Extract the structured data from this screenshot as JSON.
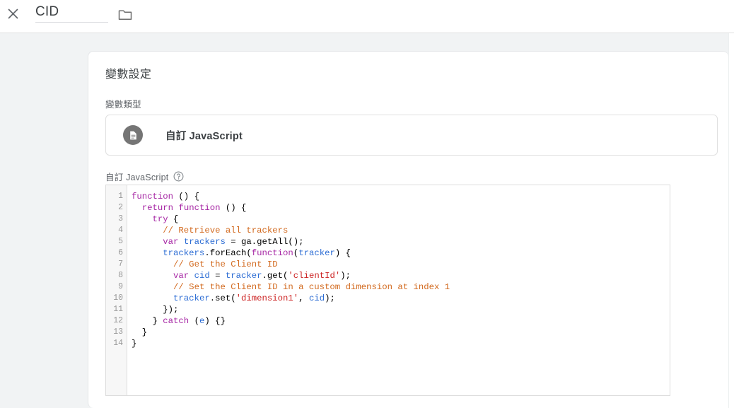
{
  "topbar": {
    "close_icon": "close-icon",
    "name_value": "CID",
    "folder_icon": "folder-icon"
  },
  "card": {
    "title": "變數設定",
    "variable_type_label": "變數類型",
    "variable_type": {
      "icon": "document-icon",
      "name": "自訂 JavaScript"
    },
    "code_label": "自訂 JavaScript",
    "help_icon": "help-circle-icon"
  },
  "editor": {
    "line_numbers": [
      1,
      2,
      3,
      4,
      5,
      6,
      7,
      8,
      9,
      10,
      11,
      12,
      13,
      14
    ],
    "lines": [
      [
        [
          "kw",
          "function"
        ],
        [
          "pln",
          " () {"
        ]
      ],
      [
        [
          "pln",
          "  "
        ],
        [
          "kw",
          "return"
        ],
        [
          "pln",
          " "
        ],
        [
          "kw",
          "function"
        ],
        [
          "pln",
          " () {"
        ]
      ],
      [
        [
          "pln",
          "    "
        ],
        [
          "kw",
          "try"
        ],
        [
          "pln",
          " {"
        ]
      ],
      [
        [
          "pln",
          "      "
        ],
        [
          "com",
          "// Retrieve all trackers"
        ]
      ],
      [
        [
          "pln",
          "      "
        ],
        [
          "kw",
          "var"
        ],
        [
          "pln",
          " "
        ],
        [
          "var",
          "trackers"
        ],
        [
          "pln",
          " = ga.getAll();"
        ]
      ],
      [
        [
          "pln",
          "      "
        ],
        [
          "var",
          "trackers"
        ],
        [
          "pln",
          ".forEach("
        ],
        [
          "kw",
          "function"
        ],
        [
          "pln",
          "("
        ],
        [
          "var",
          "tracker"
        ],
        [
          "pln",
          ") {"
        ]
      ],
      [
        [
          "pln",
          "        "
        ],
        [
          "com",
          "// Get the Client ID"
        ]
      ],
      [
        [
          "pln",
          "        "
        ],
        [
          "kw",
          "var"
        ],
        [
          "pln",
          " "
        ],
        [
          "var",
          "cid"
        ],
        [
          "pln",
          " = "
        ],
        [
          "var",
          "tracker"
        ],
        [
          "pln",
          ".get("
        ],
        [
          "str",
          "'clientId'"
        ],
        [
          "pln",
          ");"
        ]
      ],
      [
        [
          "pln",
          "        "
        ],
        [
          "com",
          "// Set the Client ID in a custom dimension at index 1"
        ]
      ],
      [
        [
          "pln",
          "        "
        ],
        [
          "var",
          "tracker"
        ],
        [
          "pln",
          ".set("
        ],
        [
          "str",
          "'dimension1'"
        ],
        [
          "pln",
          ", "
        ],
        [
          "var",
          "cid"
        ],
        [
          "pln",
          ");"
        ]
      ],
      [
        [
          "pln",
          "      });"
        ]
      ],
      [
        [
          "pln",
          "    } "
        ],
        [
          "kw",
          "catch"
        ],
        [
          "pln",
          " ("
        ],
        [
          "var",
          "e"
        ],
        [
          "pln",
          ") {}"
        ]
      ],
      [
        [
          "pln",
          "  }"
        ]
      ],
      [
        [
          "pln",
          "}"
        ]
      ]
    ]
  },
  "colors": {
    "page_background": "#f1f3f4",
    "card_background": "#ffffff",
    "keyword": "#a626a4",
    "comment": "#d2691e",
    "variable": "#2b6cd4",
    "string": "#cc2222",
    "plain": "#000000",
    "icon_circle": "#757575",
    "text_primary": "#3c4043",
    "text_secondary": "#5f6368"
  }
}
